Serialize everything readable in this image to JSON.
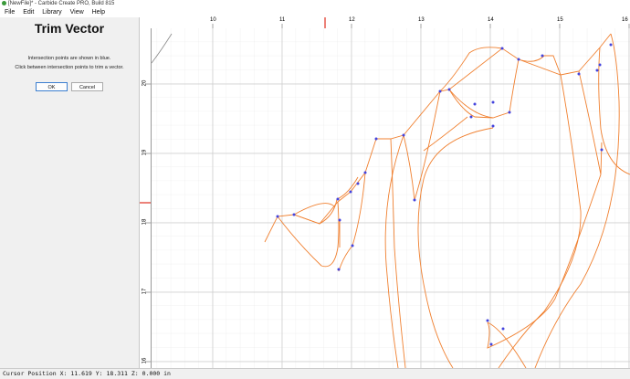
{
  "window": {
    "title": "[NewFile]* - Carbide Create PRO, Build 815"
  },
  "menu": {
    "items": [
      "File",
      "Edit",
      "Library",
      "View",
      "Help"
    ]
  },
  "panel": {
    "title": "Trim Vector",
    "hint1": "Intersection points are shown in blue.",
    "hint2": "Click between intersection points to trim a vector.",
    "ok_label": "OK",
    "cancel_label": "Cancel"
  },
  "ruler": {
    "x_labels": [
      "10",
      "11",
      "12",
      "13",
      "14",
      "15",
      "16"
    ],
    "y_labels": [
      "20",
      "19",
      "18",
      "17",
      "16"
    ]
  },
  "status": {
    "text": "Cursor Position X: 11.619 Y: 18.311 Z: 0.000 in"
  },
  "colors": {
    "vector": "#f08030",
    "node": "#4444dd",
    "marker": "#e03020"
  }
}
